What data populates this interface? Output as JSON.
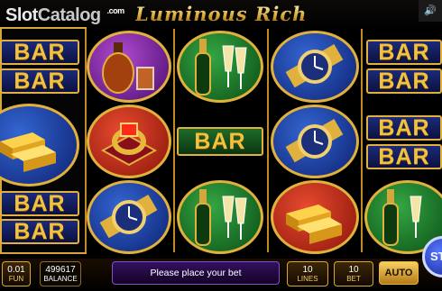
{
  "header": {
    "brand_part1": "Slot",
    "brand_part2": "Catalog",
    "brand_suffix": ".com",
    "game_title": "Luminous Rich",
    "sound_icon": "speaker-icon"
  },
  "reels": [
    {
      "symbols": [
        "BAR",
        "BAR",
        "gold-bars",
        "BAR",
        "BAR"
      ]
    },
    {
      "symbols": [
        "cognac",
        "ring",
        "watch"
      ]
    },
    {
      "symbols": [
        "champagne",
        "BAR",
        "champagne"
      ]
    },
    {
      "symbols": [
        "watch",
        "watch",
        "gold-bars"
      ]
    },
    {
      "symbols": [
        "BAR",
        "BAR",
        "BAR",
        "BAR",
        "champagne"
      ]
    }
  ],
  "center_bar": "BAR",
  "bottom": {
    "bet_value": "0.01",
    "bet_label": "FUN",
    "balance_value": "499617",
    "balance_label": "BALANCE",
    "message": "Please place your bet",
    "lines_value": "10",
    "lines_label": "LINES",
    "bet_count_value": "10",
    "bet_count_label": "BET",
    "auto_label": "AUTO",
    "spin_label": "ST"
  },
  "colors": {
    "gold": "#e0b13c",
    "bar_blue": "#1c2a7a",
    "message_purple": "#321060",
    "spin_blue": "#5577ff"
  }
}
